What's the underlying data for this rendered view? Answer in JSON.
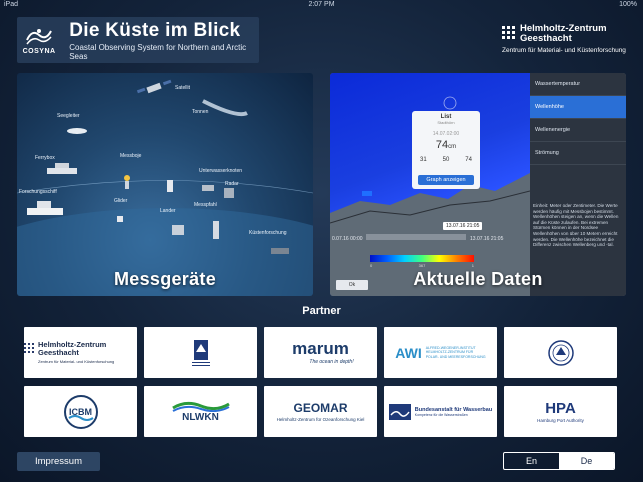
{
  "status_bar": {
    "carrier": "iPad",
    "time": "2:07 PM",
    "battery": "100%"
  },
  "header": {
    "logo_text": "COSYNA",
    "title": "Die Küste im Blick",
    "subtitle": "Coastal Observing System for Northern and Arctic Seas",
    "institution_name": "Helmholtz-Zentrum\nGeesthacht",
    "institution_sub": "Zentrum für Material- und Küstenforschung"
  },
  "panels": {
    "instruments": {
      "caption": "Messgeräte",
      "labels": [
        "Satellit",
        "Seegleiter",
        "Tonnen",
        "Ferrybox",
        "Forschungsschiff",
        "Messboje",
        "Unterwasserknoten",
        "Radar",
        "Lander",
        "Messpfahl",
        "Glider",
        "Küstenforschung"
      ]
    },
    "current_data": {
      "caption": "Aktuelle Daten",
      "sidebar_items": [
        "Wassertemperatur",
        "Wellenhöhe",
        "Wellenenergie",
        "Strömung"
      ],
      "active_item": "Wellenhöhe",
      "sidebar_text": "Einheit: Meter oder Zentimeter. Die Werte werden häufig mit Messbojen bestimmt. Wellenhöhen steigen an, wenn die Wellen auf die Küste zulaufen. Bei extremen Stürmen können in der Nordsee Wellenhöhen von über 10 Metern erreicht werden. Die Wellenhöhe bezeichnet die Differenz zwischen Wellenberg und -tal.",
      "popup": {
        "title": "List",
        "subtitle": "Stadthörn",
        "date": "14.07.02:00",
        "value": "74",
        "unit": "cm",
        "stats": [
          "31",
          "50",
          "74"
        ],
        "button": "Graph anzeigen"
      },
      "time_tag": "13.07.16 21:05",
      "time_start": "0.07.16 00:00",
      "time_end": "13.07.16 21:05",
      "legend_ticks": [
        "0",
        "367",
        "1"
      ],
      "ok_label": "Ok"
    }
  },
  "partners": {
    "title": "Partner",
    "items": [
      {
        "name": "Helmholtz-Zentrum Geesthacht",
        "sub": "Zentrum für Material- und Küstenforschung"
      },
      {
        "name": "BSH",
        "sub": ""
      },
      {
        "name": "marum",
        "sub": "The ocean in depth!"
      },
      {
        "name": "AWI",
        "sub": "ALFRED-WEGENER-INSTITUT HELMHOLTZ-ZENTRUM FÜR POLAR- UND MEERESFORSCHUNG"
      },
      {
        "name": "",
        "sub": ""
      },
      {
        "name": "ICBM",
        "sub": ""
      },
      {
        "name": "NLWKN",
        "sub": ""
      },
      {
        "name": "GEOMAR",
        "sub": "Helmholtz-Zentrum für Ozeanforschung Kiel"
      },
      {
        "name": "Bundesanstalt für Wasserbau",
        "sub": "Kompetenz für die Wasserstraßen"
      },
      {
        "name": "HPA",
        "sub": "Hamburg Port Authority"
      }
    ]
  },
  "footer": {
    "impressum": "Impressum",
    "lang_en": "En",
    "lang_de": "De",
    "selected_lang": "De"
  }
}
